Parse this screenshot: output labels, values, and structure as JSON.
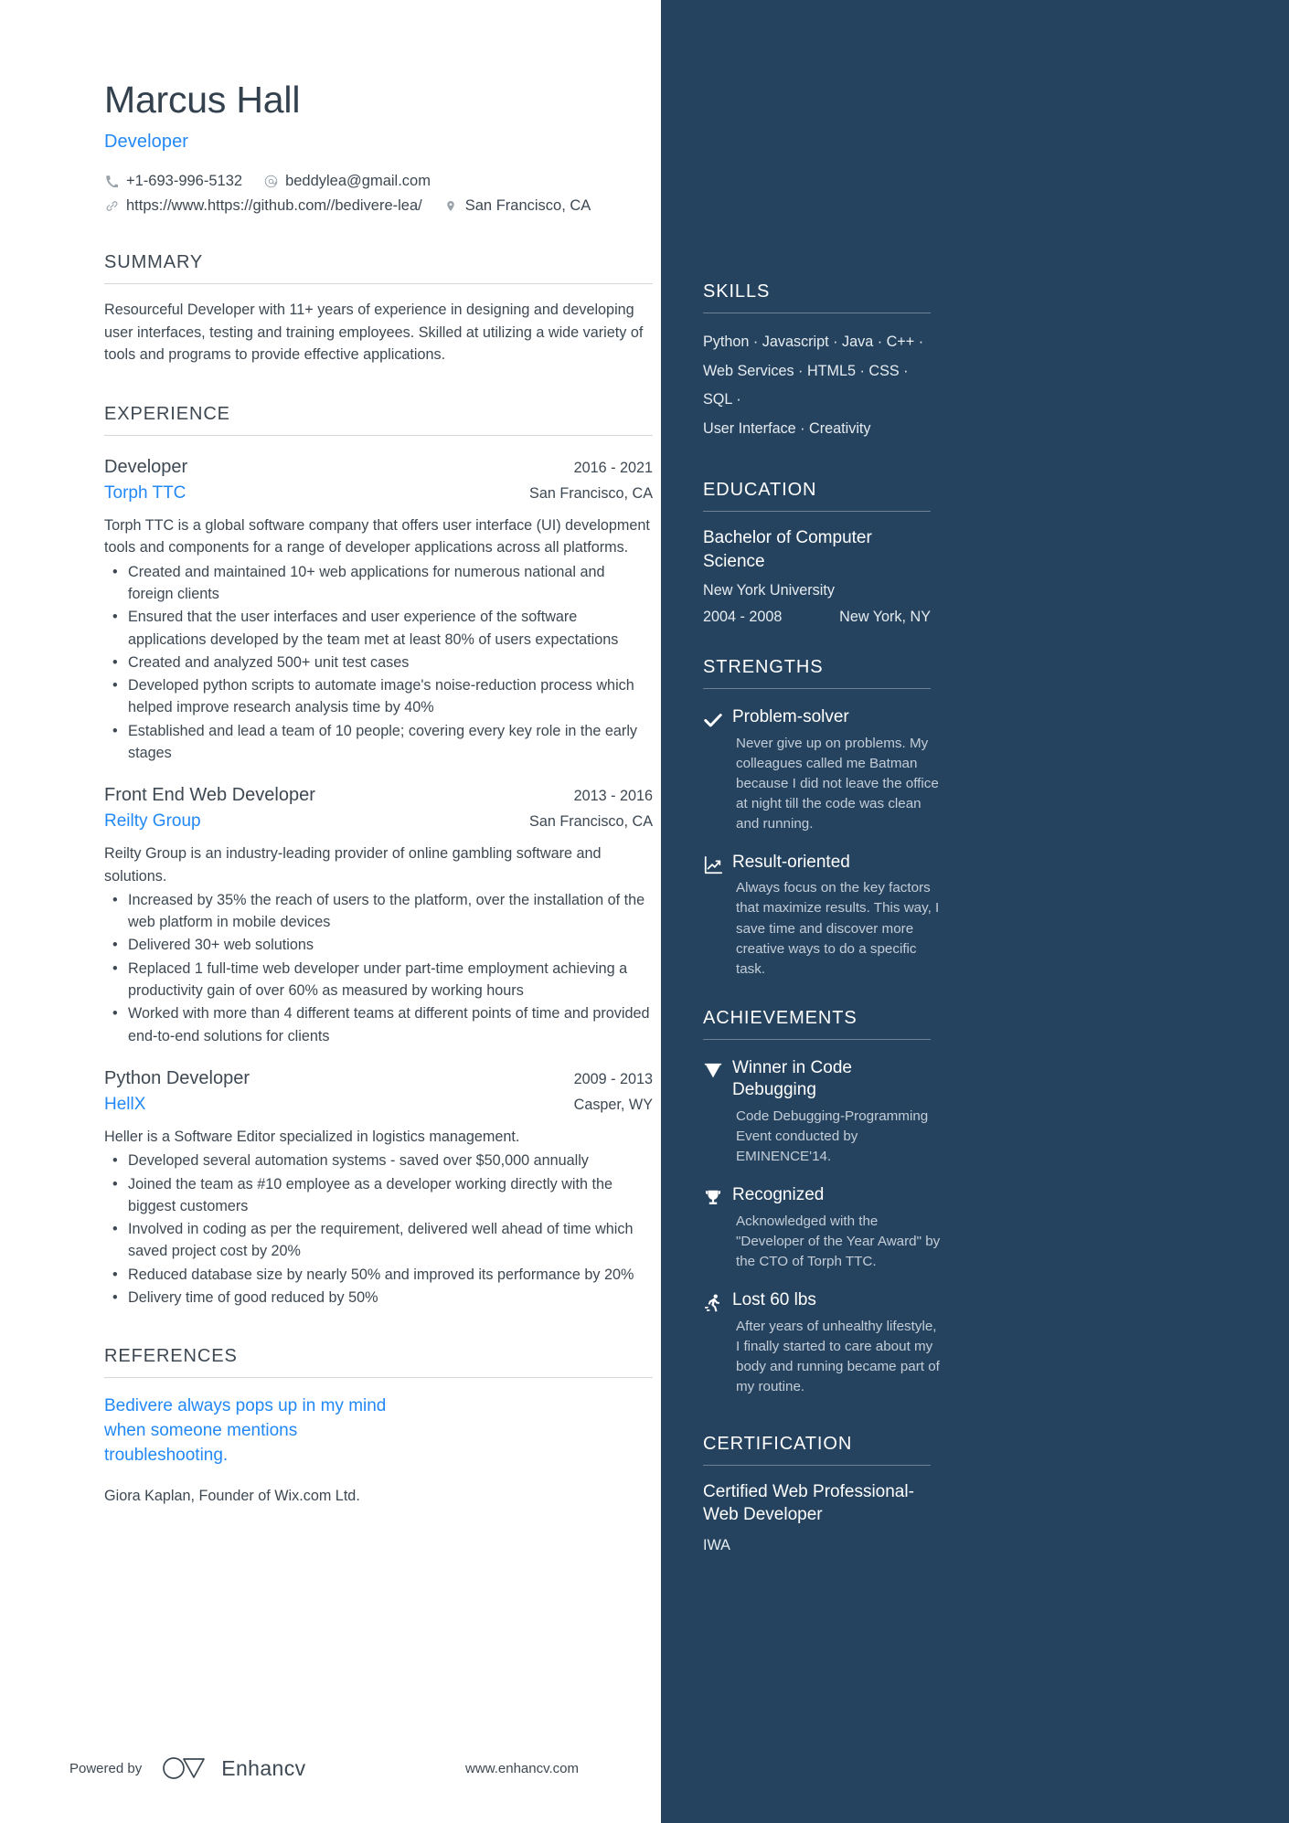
{
  "header": {
    "name": "Marcus Hall",
    "role": "Developer",
    "contacts": [
      {
        "icon": "phone-icon",
        "text": "+1-693-996-5132"
      },
      {
        "icon": "email-icon",
        "text": "beddylea@gmail.com"
      },
      {
        "icon": "link-icon",
        "text": "https://www.https://github.com//bedivere-lea/"
      },
      {
        "icon": "location-icon",
        "text": "San Francisco, CA"
      }
    ]
  },
  "summary": {
    "title": "SUMMARY",
    "text": "Resourceful Developer with 11+ years of experience in designing and developing user interfaces, testing and training employees. Skilled at utilizing a wide variety of tools and programs to provide effective applications."
  },
  "experience": {
    "title": "EXPERIENCE",
    "jobs": [
      {
        "title": "Developer",
        "date": "2016 - 2021",
        "company": "Torph TTC",
        "location": "San Francisco, CA",
        "description": "Torph TTC is a global software company that offers user interface (UI) development tools and components for a range of developer applications across all platforms.",
        "bullets": [
          "Created and maintained 10+ web applications for numerous national and foreign clients",
          "Ensured that the user interfaces and user experience of the software applications developed by the team met at least 80% of users expectations",
          "Created and analyzed 500+ unit test cases",
          "Developed python scripts to automate image's noise-reduction process which helped improve research analysis time by 40%",
          "Established and lead a team of 10 people; covering every key role in the early stages"
        ]
      },
      {
        "title": "Front End Web Developer",
        "date": "2013 - 2016",
        "company": "Reilty Group",
        "location": "San Francisco, CA",
        "description": "Reilty Group is an industry-leading provider of online gambling software and solutions.",
        "bullets": [
          "Increased by 35% the reach of users to the platform, over the installation of the web platform in mobile devices",
          "Delivered 30+ web solutions",
          "Replaced 1 full-time web developer under part-time employment achieving a productivity gain of over 60% as measured by working hours",
          "Worked with more than 4 different teams at different points of time and provided end-to-end solutions for clients"
        ]
      },
      {
        "title": "Python Developer",
        "date": "2009 - 2013",
        "company": "HellX",
        "location": "Casper, WY",
        "description": "Heller is a Software Editor specialized in logistics management.",
        "bullets": [
          "Developed several automation systems - saved over $50,000 annually",
          "Joined the team as #10 employee as a developer working directly with the biggest customers",
          "Involved in coding as per the requirement, delivered well ahead of time which saved project cost by 20%",
          "Reduced database size by nearly 50% and improved its performance by 20%",
          "Delivery time of good reduced by 50%"
        ]
      }
    ]
  },
  "references": {
    "title": "REFERENCES",
    "quote": "Bedivere always pops up in my mind when someone mentions troubleshooting.",
    "author": "Giora Kaplan, Founder of Wix.com Ltd."
  },
  "footer": {
    "powered_by": "Powered by",
    "brand": "Enhancv",
    "url": "www.enhancv.com"
  },
  "sidebar": {
    "skills": {
      "title": "SKILLS",
      "lines": [
        "Python ·  Javascript · Java · C++ ·",
        "Web Services · HTML5 · CSS · SQL ·",
        "User Interface · Creativity"
      ]
    },
    "education": {
      "title": "EDUCATION",
      "degree": "Bachelor of Computer Science",
      "school": "New York University",
      "date": "2004 - 2008",
      "location": "New York, NY"
    },
    "strengths": {
      "title": "STRENGTHS",
      "items": [
        {
          "icon": "check-icon",
          "title": "Problem-solver",
          "description": "Never give up on problems. My colleagues called me Batman because I did not leave the office at night till the code was clean and running."
        },
        {
          "icon": "trend-up-chart-icon",
          "title": "Result-oriented",
          "description": "Always focus on the key factors that maximize results. This way, I save time and discover more creative ways to do a specific task."
        }
      ]
    },
    "achievements": {
      "title": "ACHIEVEMENTS",
      "items": [
        {
          "icon": "diamond-icon",
          "title": "Winner in Code Debugging",
          "description": "Code Debugging-Programming Event conducted by EMINENCE'14."
        },
        {
          "icon": "trophy-icon",
          "title": "Recognized",
          "description": "Acknowledged with the \"Developer of the Year Award\" by the CTO of Torph TTC."
        },
        {
          "icon": "running-person-icon",
          "title": "Lost 60 lbs",
          "description": "After years of unhealthy lifestyle, I finally started to care about my body and running became part of my routine."
        }
      ]
    },
    "certification": {
      "title": "CERTIFICATION",
      "name": "Certified Web Professional-Web Developer",
      "issuer": "IWA"
    }
  },
  "colors": {
    "accent_blue": "#2288f5",
    "sidebar_bg": "#25435f",
    "text_dark": "#3d4852"
  }
}
